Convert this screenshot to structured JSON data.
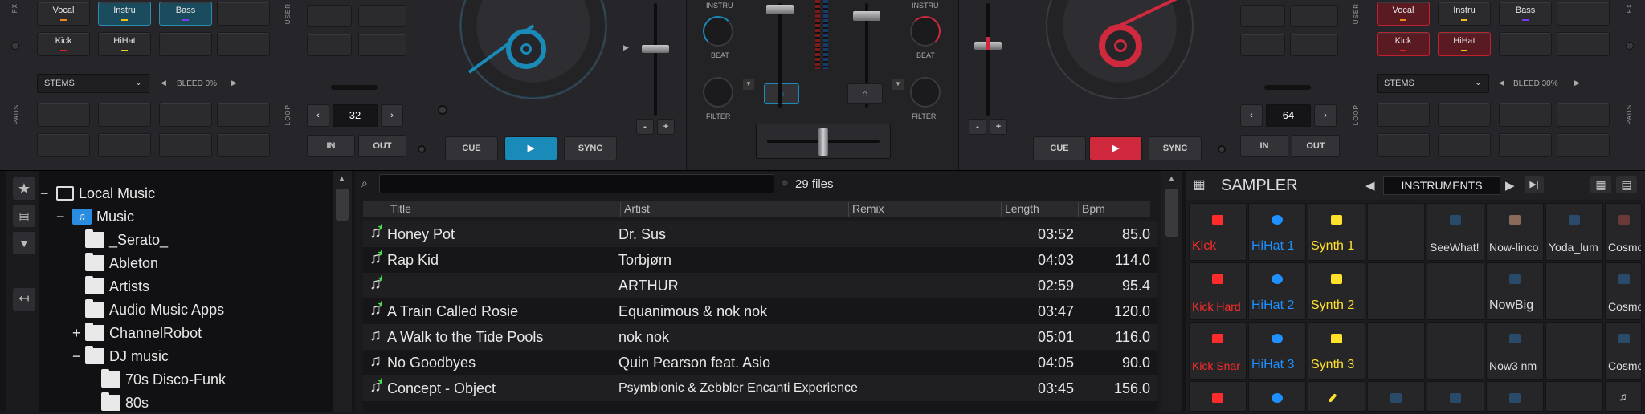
{
  "left_deck": {
    "fx_label": "FX",
    "user_label": "USER",
    "pads_label": "PADS",
    "loop_label": "LOOP",
    "stem_pads": [
      "Vocal",
      "Instru",
      "Bass",
      "Kick",
      "HiHat"
    ],
    "stems_dropdown": "STEMS",
    "bleed": "BLEED 0%",
    "loop_value": "32",
    "in_label": "IN",
    "out_label": "OUT",
    "cue_label": "CUE",
    "sync_label": "SYNC"
  },
  "right_deck": {
    "fx_label": "FX",
    "user_label": "USER",
    "pads_label": "PADS",
    "loop_label": "LOOP",
    "stem_pads": [
      "Vocal",
      "Instru",
      "Bass",
      "Kick",
      "HiHat"
    ],
    "stems_dropdown": "STEMS",
    "bleed": "BLEED 30%",
    "loop_value": "64",
    "in_label": "IN",
    "out_label": "OUT",
    "cue_label": "CUE",
    "sync_label": "SYNC"
  },
  "mixer": {
    "instru_left": "INSTRU",
    "instru_right": "INSTRU",
    "beat_left": "BEAT",
    "beat_right": "BEAT",
    "filter_left": "FILTER",
    "filter_right": "FILTER",
    "minus": "-",
    "plus": "+"
  },
  "sidebar": {
    "items": [
      {
        "label": "Local Music",
        "expander": "−"
      },
      {
        "label": "Music",
        "expander": "−"
      },
      {
        "label": "_Serato_",
        "expander": ""
      },
      {
        "label": "Ableton",
        "expander": ""
      },
      {
        "label": "Artists",
        "expander": ""
      },
      {
        "label": "Audio Music Apps",
        "expander": ""
      },
      {
        "label": "ChannelRobot",
        "expander": "+"
      },
      {
        "label": "DJ music",
        "expander": "−"
      },
      {
        "label": "70s Disco-Funk",
        "expander": ""
      },
      {
        "label": "80s",
        "expander": ""
      }
    ]
  },
  "browser": {
    "search_value": "",
    "file_count": "29 files",
    "columns": [
      "Title",
      "Artist",
      "Remix",
      "Length",
      "Bpm"
    ],
    "rows": [
      {
        "title": "Honey Pot",
        "artist": "Dr. Sus",
        "remix": "",
        "length": "03:52",
        "bpm": "85.0",
        "star": true
      },
      {
        "title": "Rap Kid",
        "artist": "Torbjørn",
        "remix": "",
        "length": "04:03",
        "bpm": "114.0",
        "star": true
      },
      {
        "title": "",
        "artist": "ARTHUR",
        "remix": "",
        "length": "02:59",
        "bpm": "95.4",
        "star": true
      },
      {
        "title": "A Train Called Rosie",
        "artist": "Equanimous & nok nok",
        "remix": "",
        "length": "03:47",
        "bpm": "120.0",
        "star": true
      },
      {
        "title": "A Walk to the Tide Pools",
        "artist": "nok nok",
        "remix": "",
        "length": "05:01",
        "bpm": "116.0",
        "star": false
      },
      {
        "title": "No Goodbyes",
        "artist": "Quin Pearson feat. Asio",
        "remix": "",
        "length": "04:05",
        "bpm": "90.0",
        "star": false
      },
      {
        "title": "Concept - Object",
        "artist": "Psymbionic & Zebbler Encanti Experience",
        "remix": "",
        "length": "03:45",
        "bpm": "156.0",
        "star": true
      }
    ]
  },
  "sampler": {
    "title": "SAMPLER",
    "category": "INSTRUMENTS",
    "grid": [
      [
        "Kick",
        "HiHat 1",
        "Synth 1",
        "",
        "SeeWhat!",
        "Now-linco",
        "Yoda_lum",
        "Cosmos_"
      ],
      [
        "Kick Hard",
        "HiHat 2",
        "Synth 2",
        "",
        "",
        "NowBig",
        "",
        "Cosmos_"
      ],
      [
        "Kick Snar",
        "HiHat 3",
        "Synth 3",
        "",
        "",
        "Now3 nm",
        "",
        "Cosmos_"
      ]
    ]
  },
  "colors": {
    "left_accent": "#1a8ab8",
    "right_accent": "#d0283c",
    "sampler_red": "#ff2b2b",
    "sampler_blue": "#1e90ff",
    "sampler_yellow": "#ffe02b"
  }
}
